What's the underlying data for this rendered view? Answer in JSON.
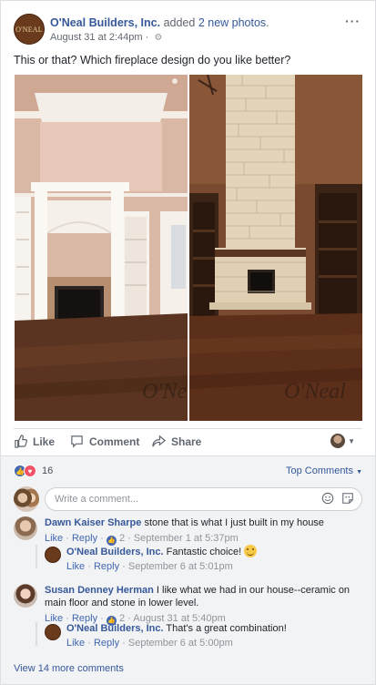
{
  "post": {
    "page_name": "O'Neal Builders, Inc.",
    "action_prefix": "added",
    "action_link": "2 new photos",
    "action_suffix": ".",
    "timestamp": "August 31 at 2:44pm",
    "timestamp_sep": "·",
    "text": "This or that? Which fireplace design do you like better?",
    "more_label": "···",
    "logo_text": "O'NEAL"
  },
  "photos": [
    {
      "watermark": "O'Neal"
    },
    {
      "watermark": "O'Neal"
    }
  ],
  "actions": {
    "like": "Like",
    "comment": "Comment",
    "share": "Share"
  },
  "reactions": {
    "count": "16",
    "top_comments": "Top Comments"
  },
  "composer": {
    "placeholder": "Write a comment..."
  },
  "comments": [
    {
      "name": "Dawn Kaiser Sharpe",
      "text": "stone that is what I just built in my house",
      "like": "Like",
      "reply": "Reply",
      "likes": "2",
      "time": "September 1 at 5:37pm",
      "replies": [
        {
          "name": "O'Neal Builders, Inc.",
          "text": "Fantastic choice!",
          "like": "Like",
          "reply": "Reply",
          "time": "September 6 at 5:01pm"
        }
      ]
    },
    {
      "name": "Susan Denney Herman",
      "text": "I like what we had in our house--ceramic on main floor and stone in lower level.",
      "like": "Like",
      "reply": "Reply",
      "likes": "2",
      "time": "August 31 at 5:40pm",
      "replies": [
        {
          "name": "O'Neal Builders, Inc.",
          "text": "That's a great combination!",
          "like": "Like",
          "reply": "Reply",
          "time": "September 6 at 5:00pm"
        }
      ]
    }
  ],
  "view_more": "View 14 more comments",
  "colors": {
    "link": "#365899",
    "like_blue": "#4267b2",
    "love_red": "#f25268",
    "meta_gray": "#90949c"
  }
}
